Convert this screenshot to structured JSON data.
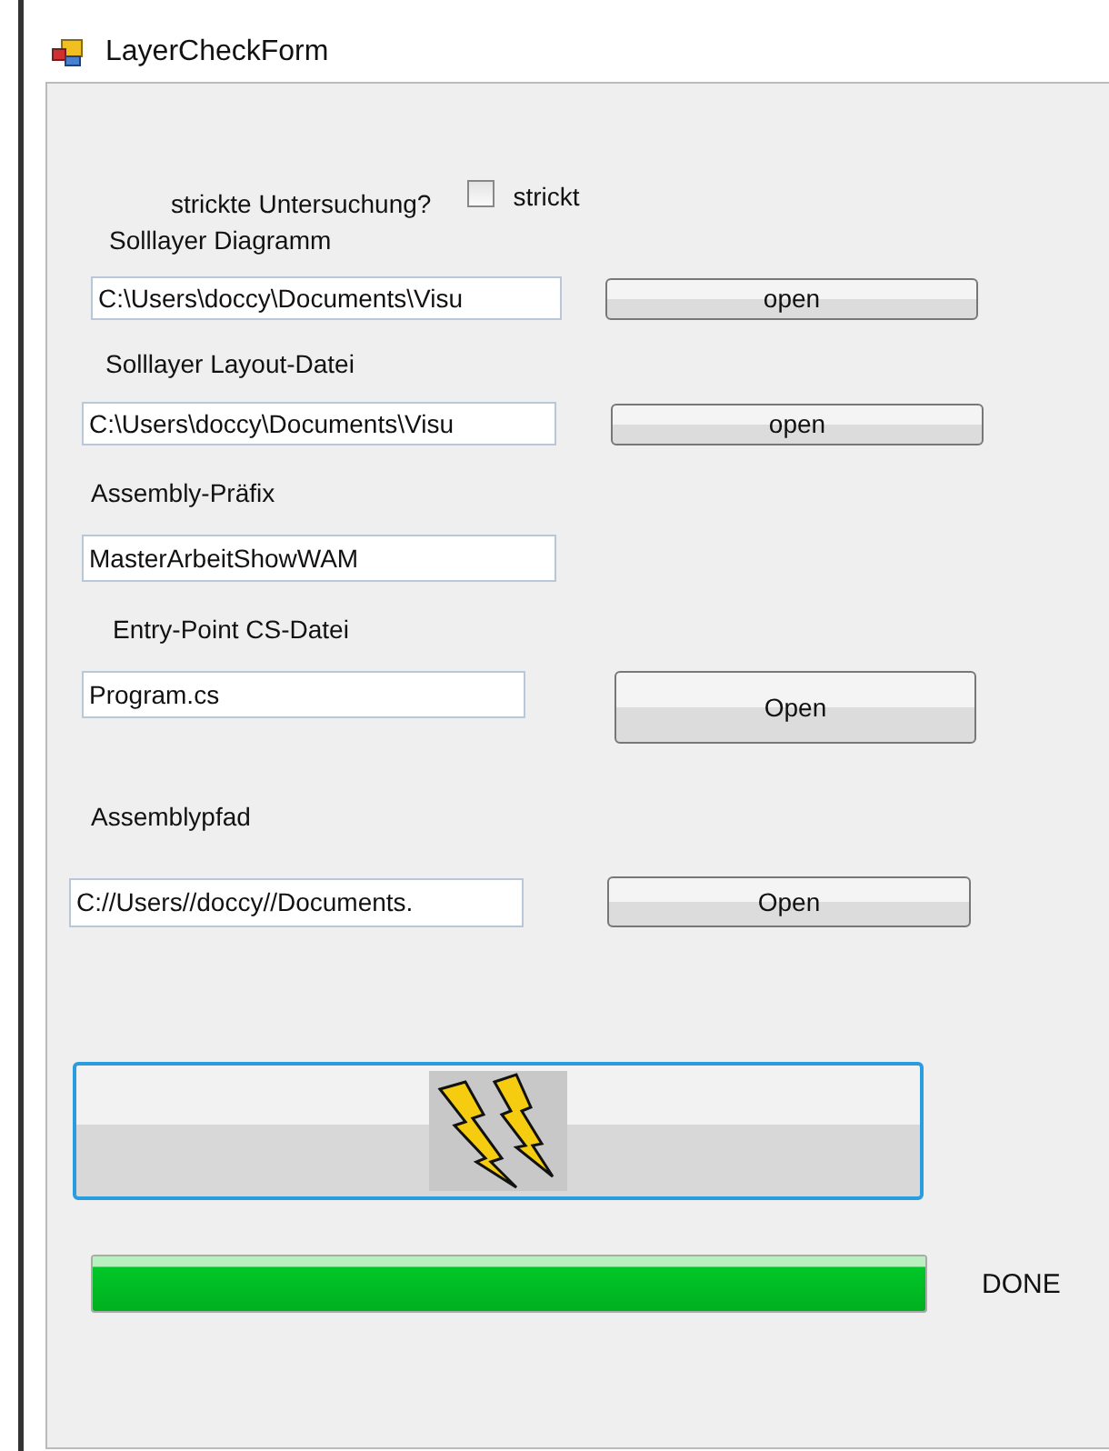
{
  "window": {
    "title": "LayerCheckForm"
  },
  "strict": {
    "label": "strickte Untersuchung?",
    "checkbox_label": "strickt",
    "checked": false
  },
  "fields": [
    {
      "label": "Solllayer Diagramm",
      "value": "C:\\Users\\doccy\\Documents\\Visu",
      "button": "open"
    },
    {
      "label": "Solllayer Layout-Datei",
      "value": "C:\\Users\\doccy\\Documents\\Visu",
      "button": "open"
    },
    {
      "label": "Assembly-Präfix",
      "value": "MasterArbeitShowWAM"
    },
    {
      "label": "Entry-Point CS-Datei",
      "value": "Program.cs",
      "button": "Open"
    },
    {
      "label": "Assemblypfad",
      "value": "C://Users//doccy//Documents.",
      "button": "Open"
    }
  ],
  "progress": {
    "level": 1,
    "status": "DONE"
  }
}
